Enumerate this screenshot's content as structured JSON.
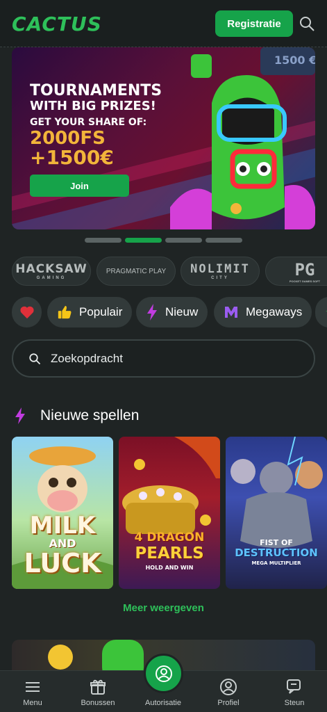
{
  "header": {
    "logo": "CACTUS",
    "register_label": "Registratie",
    "search_icon": "search-icon"
  },
  "banner": {
    "title_line1": "TOURNAMENTS",
    "title_line2": "WITH BIG PRIZES!",
    "share_text": "GET YOUR SHARE OF:",
    "prize_fs": "2000FS",
    "prize_eur": "+1500€",
    "join_label": "Join",
    "art_label": "1500 €"
  },
  "carousel": {
    "count": 4,
    "active": 2
  },
  "providers": [
    "HACKSAW",
    "PRAGMATIC PLAY",
    "NOLIMIT",
    "PG"
  ],
  "provider_sub": {
    "hacksaw": "GAMING",
    "nolimit": "CITY",
    "pg": "POCKET GAMES SOFT"
  },
  "categories": {
    "favorites_icon": "heart-icon",
    "popular": "Populair",
    "new": "Nieuw",
    "megaways": "Megaways"
  },
  "search": {
    "placeholder": "Zoekopdracht"
  },
  "section": {
    "title": "Nieuwe spellen"
  },
  "games": {
    "g1_line1": "MILK",
    "g1_line2": "AND",
    "g1_line3": "LUCK",
    "g2_line1": "4 DRAGON",
    "g2_line2": "PEARLS",
    "g2_line3": "HOLD AND WIN",
    "g3_line1": "FIST OF",
    "g3_line2": "DESTRUCTION",
    "g3_line3": "MEGA MULTIPLIER"
  },
  "more_label": "Meer weergeven",
  "nav": {
    "menu": "Menu",
    "bonuses": "Bonussen",
    "auth": "Autorisatie",
    "profile": "Profiel",
    "support": "Steun"
  },
  "colors": {
    "accent": "#16a34a",
    "background": "#1f2424",
    "gold": "#f2b53a"
  }
}
